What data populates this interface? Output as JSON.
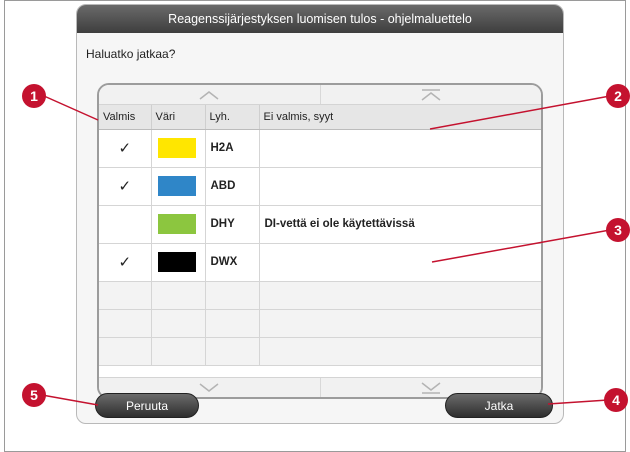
{
  "dialog": {
    "title": "Reagenssijärjestyksen luomisen tulos - ohjelmaluettelo",
    "question": "Haluatko jatkaa?"
  },
  "table": {
    "headers": [
      "Valmis",
      "Väri",
      "Lyh.",
      "Ei valmis, syyt"
    ],
    "rows": [
      {
        "ready": "✓",
        "color": "#ffe600",
        "abbr": "H2A",
        "reason": ""
      },
      {
        "ready": "✓",
        "color": "#2f86c8",
        "abbr": "ABD",
        "reason": ""
      },
      {
        "ready": "",
        "color": "#8cc63f",
        "abbr": "DHY",
        "reason": "DI-vettä ei ole käytettävissä"
      },
      {
        "ready": "✓",
        "color": "#000000",
        "abbr": "DWX",
        "reason": ""
      }
    ]
  },
  "scroll": {
    "up_icon": "chevron-up-icon",
    "top_icon": "scroll-to-top-icon",
    "down_icon": "chevron-down-icon",
    "bottom_icon": "scroll-to-bottom-icon"
  },
  "buttons": {
    "cancel_label": "Peruuta",
    "continue_label": "Jatka"
  },
  "callouts": [
    "1",
    "2",
    "3",
    "4",
    "5"
  ],
  "accent_color": "#c4122f"
}
